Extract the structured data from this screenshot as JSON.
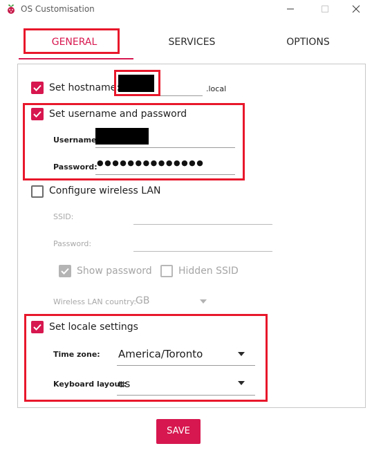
{
  "window": {
    "title": "OS Customisation"
  },
  "tabs": [
    {
      "label": "GENERAL",
      "active": true
    },
    {
      "label": "SERVICES",
      "active": false
    },
    {
      "label": "OPTIONS",
      "active": false
    }
  ],
  "general": {
    "hostname": {
      "label": "Set hostname:",
      "checked": true,
      "suffix": ".local"
    },
    "user": {
      "label": "Set username and password",
      "checked": true,
      "username_label": "Username:",
      "password_label": "Password:",
      "password_mask": "●●●●●●●●●●●●●●"
    },
    "wireless": {
      "label": "Configure wireless LAN",
      "checked": false,
      "ssid_label": "SSID:",
      "password_label": "Password:",
      "show_password_label": "Show password",
      "show_password_checked": true,
      "hidden_ssid_label": "Hidden SSID",
      "hidden_ssid_checked": false,
      "country_label": "Wireless LAN country:",
      "country_value": "GB"
    },
    "locale": {
      "label": "Set locale settings",
      "checked": true,
      "timezone_label": "Time zone:",
      "timezone_value": "America/Toronto",
      "keyboard_label": "Keyboard layout:",
      "keyboard_value": "us"
    }
  },
  "footer": {
    "save_label": "SAVE"
  },
  "colors": {
    "accent": "#d7174f",
    "highlight": "#e8172b"
  }
}
